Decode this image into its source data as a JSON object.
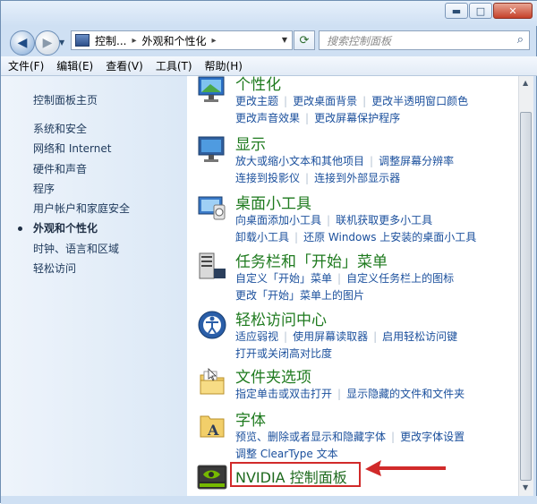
{
  "window": {
    "min_label": "▬",
    "max_label": "□",
    "close_label": "✕"
  },
  "nav": {
    "back_icon": "◀",
    "forward_icon": "▶"
  },
  "address": {
    "crumb1": "控制...",
    "crumb2": "外观和个性化",
    "sep": "▸"
  },
  "search": {
    "placeholder": "搜索控制面板"
  },
  "menu": [
    "文件(F)",
    "编辑(E)",
    "查看(V)",
    "工具(T)",
    "帮助(H)"
  ],
  "sidebar": {
    "home": "控制面板主页",
    "items": [
      "系统和安全",
      "网络和 Internet",
      "硬件和声音",
      "程序",
      "用户帐户和家庭安全",
      "外观和个性化",
      "时钟、语言和区域",
      "轻松访问"
    ],
    "active_index": 5
  },
  "sections": [
    {
      "title": "个性化",
      "links": [
        [
          "更改主题",
          "更改桌面背景",
          "更改半透明窗口颜色"
        ],
        [
          "更改声音效果",
          "更改屏幕保护程序"
        ]
      ]
    },
    {
      "title": "显示",
      "links": [
        [
          "放大或缩小文本和其他项目",
          "调整屏幕分辨率"
        ],
        [
          "连接到投影仪",
          "连接到外部显示器"
        ]
      ]
    },
    {
      "title": "桌面小工具",
      "links": [
        [
          "向桌面添加小工具",
          "联机获取更多小工具"
        ],
        [
          "卸载小工具",
          "还原 Windows 上安装的桌面小工具"
        ]
      ]
    },
    {
      "title": "任务栏和「开始」菜单",
      "links": [
        [
          "自定义「开始」菜单",
          "自定义任务栏上的图标"
        ],
        [
          "更改「开始」菜单上的图片"
        ]
      ]
    },
    {
      "title": "轻松访问中心",
      "links": [
        [
          "适应弱视",
          "使用屏幕读取器",
          "启用轻松访问键"
        ],
        [
          "打开或关闭高对比度"
        ]
      ]
    },
    {
      "title": "文件夹选项",
      "links": [
        [
          "指定单击或双击打开",
          "显示隐藏的文件和文件夹"
        ]
      ]
    },
    {
      "title": "字体",
      "links": [
        [
          "预览、删除或者显示和隐藏字体",
          "更改字体设置"
        ],
        [
          "调整 ClearType 文本"
        ]
      ]
    }
  ],
  "nvidia": {
    "label": "NVIDIA 控制面板"
  },
  "colors": {
    "section_title": "#1e7a1e",
    "link": "#1a4f9c",
    "highlight": "#d12a2a"
  }
}
